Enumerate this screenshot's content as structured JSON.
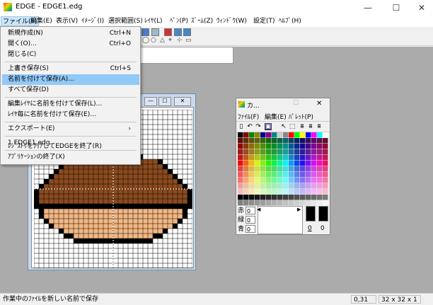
{
  "window": {
    "title": "EDGE - EDGE1.edg",
    "minimize": "—",
    "maximize": "☐",
    "close": "✕"
  },
  "menubar": [
    "ファイル(F)",
    "編集(E)",
    "表示(V)",
    "ｲﾒｰｼﾞ(I)",
    "選択範囲(S)",
    "ﾚｲﾔ(L)",
    "ﾍﾟﾝ(P)",
    "ｽﾞｰﾑ(Z)",
    "ｳｨﾝﾄﾞｳ(W)",
    "設定(T)",
    "ﾍﾙﾌﾟ(H)"
  ],
  "file_menu": [
    {
      "label": "新規作成(N)",
      "shortcut": "Ctrl+N"
    },
    {
      "label": "開く(O)...",
      "shortcut": "Ctrl+O"
    },
    {
      "label": "閉じる(C)",
      "shortcut": ""
    },
    {
      "label": "上書き保存(S)",
      "shortcut": "Ctrl+S"
    },
    {
      "label": "名前を付けて保存(A)...",
      "shortcut": ""
    },
    {
      "label": "すべて保存(D)",
      "shortcut": ""
    },
    {
      "label": "編集ﾚｲﾔに名前を付けて保存(L)...",
      "shortcut": ""
    },
    {
      "label": "ﾚｲﾔ毎に名前を付けて保存(E)...",
      "shortcut": ""
    },
    {
      "label": "エクスポート(E)",
      "shortcut": "›"
    },
    {
      "label": "1 EDGE1.edg",
      "shortcut": ""
    },
    {
      "label": "ﾚｼﾞｽﾄﾘをｸﾘｱしてEDGEを終了(R)",
      "shortcut": ""
    },
    {
      "label": "ｱﾌﾟﾘｹｰｼｮﾝの終了(X)",
      "shortcut": ""
    }
  ],
  "palette_window": {
    "title": "カ...",
    "menu": [
      "ﾌｧｲﾙ(F)",
      "編集(E)",
      "ﾊﾟﾚｯﾄ(P)"
    ],
    "rgb_labels": [
      "赤",
      "緑",
      "青"
    ],
    "rgb_values": [
      "0",
      "0",
      "0"
    ],
    "fg_index": "0",
    "bg_index": "0"
  },
  "statusbar": {
    "message": "作業中のﾌｧｲﾙを新しい名前で保存",
    "coords": "0,31",
    "size": "32 x 32 x 1"
  }
}
